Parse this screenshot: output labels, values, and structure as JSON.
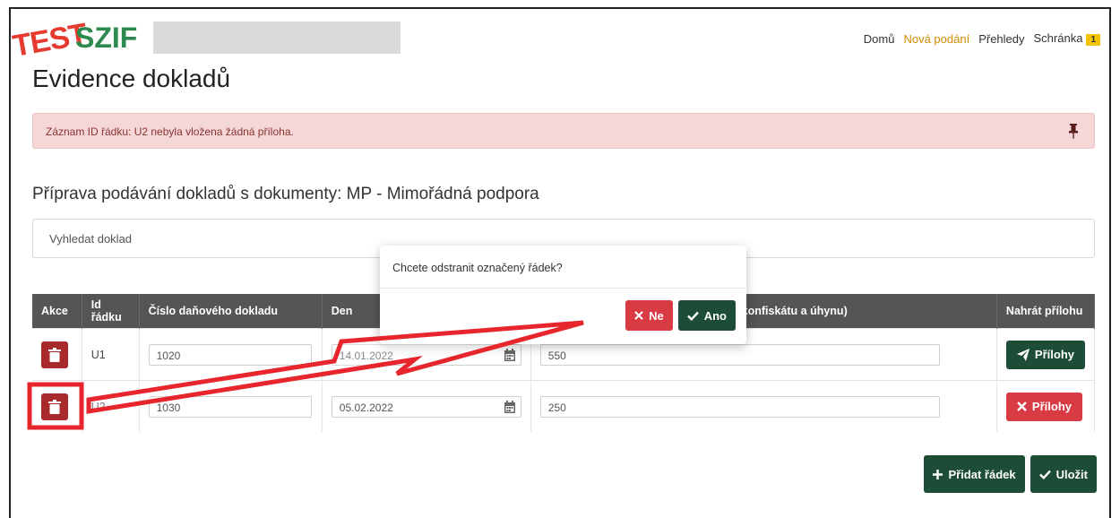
{
  "header": {
    "logo_test": "TEST",
    "logo_szif": "SZIF",
    "nav": [
      {
        "label": "Domů",
        "active": false
      },
      {
        "label": "Nová podání",
        "active": true
      },
      {
        "label": "Přehledy",
        "active": false
      },
      {
        "label": "Schránka",
        "active": false
      }
    ],
    "inbox_badge": "1"
  },
  "page": {
    "title": "Evidence dokladů",
    "alert_text": "Záznam ID řádku: U2 nebyla vložena žádná příloha.",
    "section_title": "Příprava podávání dokladů s dokumenty: MP - Mimořádná podpora",
    "search_placeholder": "Vyhledat doklad"
  },
  "table": {
    "headers": [
      "Akce",
      "Id řádku",
      "Číslo daňového dokladu",
      "Den",
      "s (bez konfiskátu a úhynu)",
      "Nahrát přílohu"
    ],
    "rows": [
      {
        "id": "U1",
        "doc_number": "1020",
        "date": "14.01.2022",
        "amount": "550",
        "attach_label": "Přílohy",
        "attach_state": "ok"
      },
      {
        "id": "U2",
        "doc_number": "1030",
        "date": "05.02.2022",
        "amount": "250",
        "attach_label": "Přílohy",
        "attach_state": "missing"
      }
    ]
  },
  "modal": {
    "question": "Chcete odstranit označený řádek?",
    "no_label": "Ne",
    "yes_label": "Ano"
  },
  "actions": {
    "add_row_label": "Přidat řádek",
    "save_label": "Uložit"
  },
  "colors": {
    "danger": "#a82a2a",
    "primary_green": "#1d4d36",
    "annotation_red": "#e6262c"
  }
}
